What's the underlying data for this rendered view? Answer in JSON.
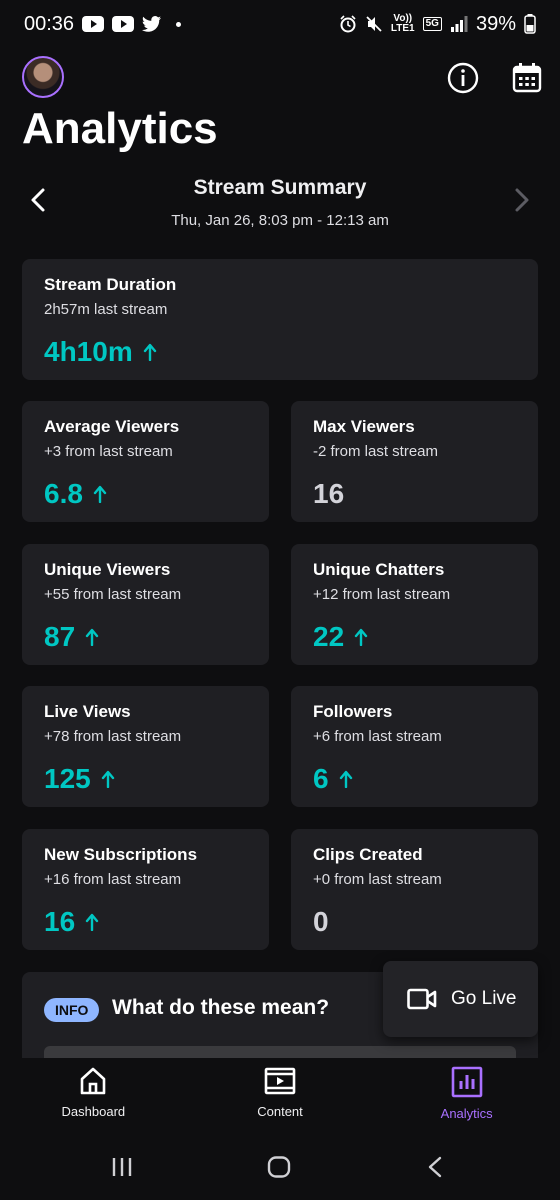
{
  "status_bar": {
    "time": "00:36",
    "network_top": "Vo))",
    "network_bottom": "LTE1",
    "network_gen": "5G",
    "battery": "39%"
  },
  "header": {
    "title": "Analytics"
  },
  "summary": {
    "title": "Stream Summary",
    "date_range": "Thu, Jan 26, 8:03 pm - 12:13 am"
  },
  "stats": {
    "duration": {
      "title": "Stream Duration",
      "sub": "2h57m last stream",
      "value": "4h10m"
    },
    "avg_viewers": {
      "title": "Average Viewers",
      "sub": "+3 from last stream",
      "value": "6.8"
    },
    "max_viewers": {
      "title": "Max Viewers",
      "sub": "-2 from last stream",
      "value": "16"
    },
    "unique_viewers": {
      "title": "Unique Viewers",
      "sub": "+55 from last stream",
      "value": "87"
    },
    "unique_chatters": {
      "title": "Unique Chatters",
      "sub": "+12 from last stream",
      "value": "22"
    },
    "live_views": {
      "title": "Live Views",
      "sub": "+78 from last stream",
      "value": "125"
    },
    "followers": {
      "title": "Followers",
      "sub": "+6 from last stream",
      "value": "6"
    },
    "new_subs": {
      "title": "New Subscriptions",
      "sub": "+16 from last stream",
      "value": "16"
    },
    "clips": {
      "title": "Clips Created",
      "sub": "+0 from last stream",
      "value": "0"
    }
  },
  "info_section": {
    "badge": "INFO",
    "title": "What do these mean?"
  },
  "go_live": {
    "label": "Go Live"
  },
  "bottom_nav": {
    "dashboard": "Dashboard",
    "content": "Content",
    "analytics": "Analytics"
  },
  "colors": {
    "background": "#0e0e10",
    "card": "#1f1f23",
    "positive": "#00c7c3",
    "accent": "#a970ff",
    "info_badge": "#8fb6ff"
  }
}
